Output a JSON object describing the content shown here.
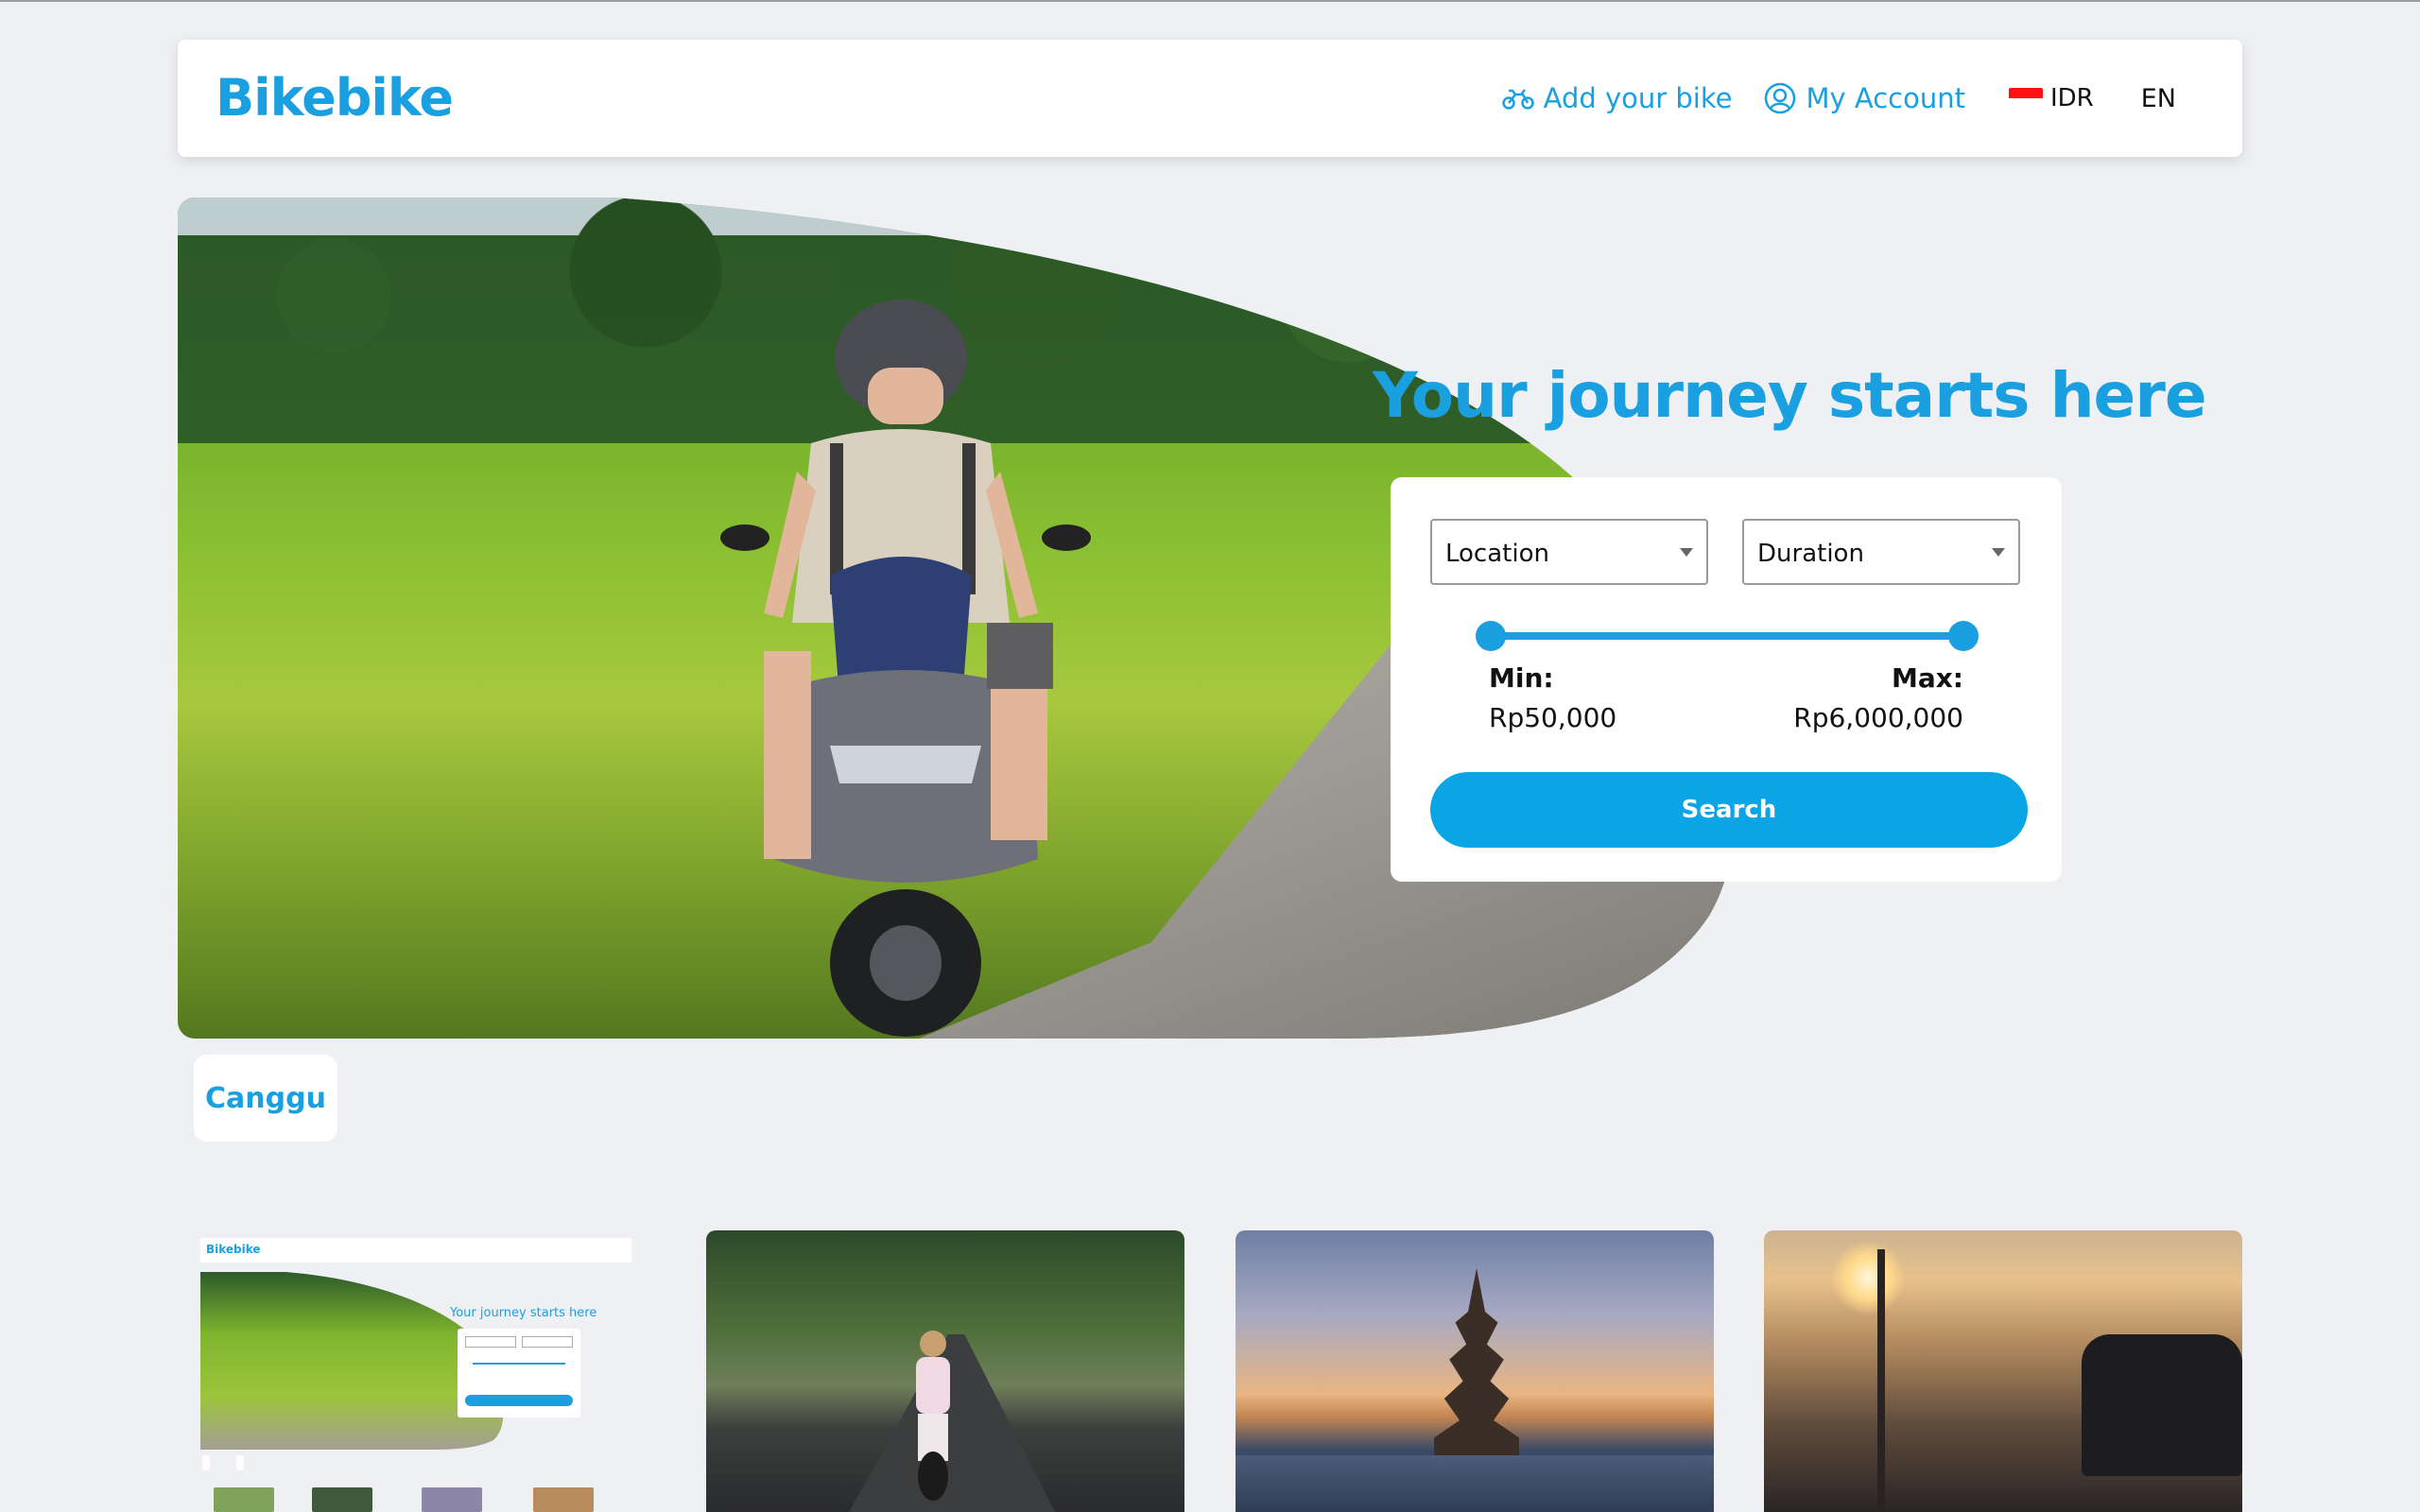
{
  "header": {
    "logo": "Bikebike",
    "add_bike": "Add your bike",
    "my_account": "My Account",
    "currency": "IDR",
    "language": "EN"
  },
  "hero": {
    "title": "Your journey starts here"
  },
  "search": {
    "location_placeholder": "Location",
    "duration_placeholder": "Duration",
    "min_label": "Min:",
    "max_label": "Max:",
    "min_value": "Rp50,000",
    "max_value": "Rp6,000,000",
    "button": "Search"
  },
  "locations": [
    {
      "label": "Canggu"
    }
  ],
  "colors": {
    "accent": "#1aa0e0",
    "button": "#0ba5e6",
    "background": "#eef0f3"
  },
  "icons": {
    "add_bike": "motorbike-icon",
    "account": "user-circle-icon",
    "currency_flag": "indonesia-flag-icon"
  }
}
